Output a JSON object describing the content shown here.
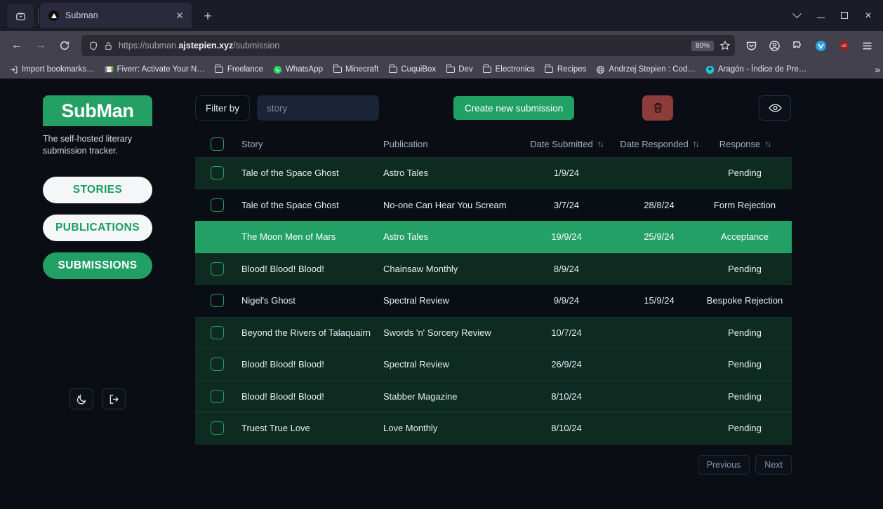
{
  "browser": {
    "tab": {
      "title": "Subman",
      "favicon": "triangle-favicon",
      "close_label": "✕"
    },
    "new_tab_label": "+",
    "list_all_tabs_label": "⌄",
    "window": {
      "minimize": "–",
      "maximize": "□",
      "close": "✕"
    },
    "nav": {
      "back": "←",
      "forward": "→",
      "reload": "⟳"
    },
    "url": {
      "prefix": "https://subman.",
      "host": "ajstepien.xyz",
      "path": "/submission"
    },
    "zoom_level": "80%",
    "bookmark_star": "☆",
    "toolbar_icons": [
      "pocket-icon",
      "account-icon",
      "extensions-icon",
      "vpn-icon",
      "ublock-icon",
      "menu-icon"
    ],
    "bookmarks": [
      {
        "label": "Import bookmarks…",
        "icon": "import-icon"
      },
      {
        "label": "Fiverr: Activate Your N…",
        "icon": "gmail-icon"
      },
      {
        "label": "Freelance",
        "icon": "folder-icon"
      },
      {
        "label": "WhatsApp",
        "icon": "whatsapp-icon"
      },
      {
        "label": "Minecraft",
        "icon": "folder-icon"
      },
      {
        "label": "CuquiBox",
        "icon": "folder-icon"
      },
      {
        "label": "Dev",
        "icon": "folder-icon"
      },
      {
        "label": "Electronics",
        "icon": "folder-icon"
      },
      {
        "label": "Recipes",
        "icon": "folder-icon"
      },
      {
        "label": "Andrzej Stepien : Cod…",
        "icon": "globe-icon"
      },
      {
        "label": "Aragón - Índice de Pre…",
        "icon": "teal-circle-icon"
      }
    ],
    "bookmarks_overflow": "»"
  },
  "sidebar": {
    "logo": "SubMan",
    "tagline": "The self-hosted literary submission tracker.",
    "nav": [
      {
        "label": "STORIES",
        "active": false
      },
      {
        "label": "PUBLICATIONS",
        "active": false
      },
      {
        "label": "SUBMISSIONS",
        "active": true
      }
    ],
    "bottom_buttons": [
      {
        "name": "dark-mode-toggle",
        "icon": "moon-icon"
      },
      {
        "name": "logout-button",
        "icon": "logout-icon"
      }
    ]
  },
  "toolbar": {
    "filter_by_label": "Filter by",
    "filter_placeholder": "story",
    "filter_value": "",
    "create_label": "Create new submission",
    "delete_icon": "trash-icon",
    "view_icon": "eye-icon"
  },
  "table": {
    "columns": [
      {
        "key": "checkbox",
        "label": "",
        "sortable": false
      },
      {
        "key": "story",
        "label": "Story",
        "sortable": false
      },
      {
        "key": "publication",
        "label": "Publication",
        "sortable": false
      },
      {
        "key": "date_submitted",
        "label": "Date Submitted",
        "sortable": true
      },
      {
        "key": "date_responded",
        "label": "Date Responded",
        "sortable": true
      },
      {
        "key": "response",
        "label": "Response",
        "sortable": true
      }
    ],
    "sort_glyph": "↑↓",
    "rows": [
      {
        "story": "Tale of the Space Ghost",
        "publication": "Astro Tales",
        "date_submitted": "1/9/24",
        "date_responded": "",
        "response": "Pending",
        "style": "green",
        "selected": false
      },
      {
        "story": "Tale of the Space Ghost",
        "publication": "No-one Can Hear You Scream",
        "date_submitted": "3/7/24",
        "date_responded": "28/8/24",
        "response": "Form Rejection",
        "style": "dark",
        "selected": false
      },
      {
        "story": "The Moon Men of Mars",
        "publication": "Astro Tales",
        "date_submitted": "19/9/24",
        "date_responded": "25/9/24",
        "response": "Acceptance",
        "style": "sel",
        "selected": true
      },
      {
        "story": "Blood! Blood! Blood!",
        "publication": "Chainsaw Monthly",
        "date_submitted": "8/9/24",
        "date_responded": "",
        "response": "Pending",
        "style": "green",
        "selected": false
      },
      {
        "story": "Nigel's Ghost",
        "publication": "Spectral Review",
        "date_submitted": "9/9/24",
        "date_responded": "15/9/24",
        "response": "Bespoke Rejection",
        "style": "dark",
        "selected": false
      },
      {
        "story": "Beyond the Rivers of Talaquairn",
        "publication": "Swords 'n' Sorcery Review",
        "date_submitted": "10/7/24",
        "date_responded": "",
        "response": "Pending",
        "style": "green",
        "selected": false
      },
      {
        "story": "Blood! Blood! Blood!",
        "publication": "Spectral Review",
        "date_submitted": "26/9/24",
        "date_responded": "",
        "response": "Pending",
        "style": "green",
        "selected": false
      },
      {
        "story": "Blood! Blood! Blood!",
        "publication": "Stabber Magazine",
        "date_submitted": "8/10/24",
        "date_responded": "",
        "response": "Pending",
        "style": "green",
        "selected": false
      },
      {
        "story": "Truest True Love",
        "publication": "Love Monthly",
        "date_submitted": "8/10/24",
        "date_responded": "",
        "response": "Pending",
        "style": "green",
        "selected": false
      }
    ]
  },
  "pagination": {
    "previous_label": "Previous",
    "next_label": "Next"
  },
  "colors": {
    "brand_green": "#21a066",
    "row_green": "#0e2b22",
    "row_dark": "#090e15",
    "selected_green": "#23a066",
    "delete_red": "#8c3d39",
    "page_bg": "#0a0e14"
  }
}
